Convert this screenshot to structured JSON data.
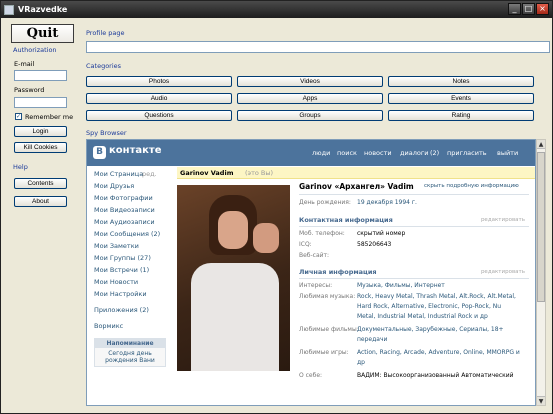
{
  "window": {
    "title": "VRazvedke",
    "min": "_",
    "max": "□",
    "close": "×"
  },
  "left": {
    "quit": "Quit",
    "authorization": "Authorization",
    "email_label": "E-mail",
    "email_value": "",
    "password_label": "Password",
    "password_value": "",
    "remember_label": "Remember me",
    "remember_checked": "✓",
    "login": "Login",
    "kill_cookies": "Kill Cookies",
    "help": "Help",
    "contents": "Contents",
    "about": "About"
  },
  "profile_page": {
    "label": "Profile page",
    "value": ""
  },
  "categories": {
    "label": "Categories",
    "buttons": [
      "Photos",
      "Videos",
      "Notes",
      "Audio",
      "Apps",
      "Events",
      "Questions",
      "Groups",
      "Rating"
    ]
  },
  "spy_browser": {
    "label": "Spy Browser"
  },
  "vk": {
    "logo": "В",
    "word": "контакте",
    "nav": [
      "люди",
      "поиск",
      "новости",
      "диалоги",
      "(2)",
      "пригласить",
      "выйти"
    ],
    "menu": [
      "Мои Страница",
      "ред.",
      "Мои Друзья",
      "Мои Фотографии",
      "Мои Видеозаписи",
      "Мои Аудиозаписи",
      "Мои Сообщения (2)",
      "Мои Заметки",
      "Мои Группы (27)",
      "Мои Встречи (1)",
      "Мои Новости",
      "Мои Настройки",
      "Приложения (2)",
      "Вормикс"
    ],
    "remind_title": "Напоминание",
    "remind_text": "Сегодня день рождения Вани",
    "profile_name": "Garinov Vadim",
    "profile_note": "(это Вы)",
    "full_name": "Garinov «Архангел» Vadim",
    "hide_info": "скрыть подробную информацию",
    "birthday_label": "День рождения:",
    "birthday_value": "19 декабря 1994 г.",
    "contacts_header": "Контактная информация",
    "edit": "редактировать",
    "mobile_label": "Моб. телефон:",
    "mobile_value": "скрытий номер",
    "icq_label": "ICQ:",
    "icq_value": "585206643",
    "site_label": "Веб-сайт:",
    "personal_header": "Личная информация",
    "interests_label": "Интересы:",
    "interests_value": "Музыка, Фильмы, Интернет",
    "music_label": "Любимая музыка:",
    "music_value_1": "Rock, Heavy Metal, Thrash Metal, Alt.Rock, Alt.Metal,",
    "music_value_2": "Hard Rock, Alternative, Electronic, Pop-Rock, Nu",
    "music_value_3": "Metal, Industrial Metal, Industrial Rock и др",
    "films_label": "Любимые фильмы:",
    "films_value_1": "Документальные, Зарубежные, Сериалы, 18+",
    "films_value_2": "передачи",
    "games_label": "Любимые игры:",
    "games_value_1": "Action, Racing, Arcade, Adventure, Online, MMORPG и",
    "games_value_2": "др",
    "about_label": "О себе:",
    "about_value": "ВАДИМ: Высокоорганизованный Автоматический"
  }
}
